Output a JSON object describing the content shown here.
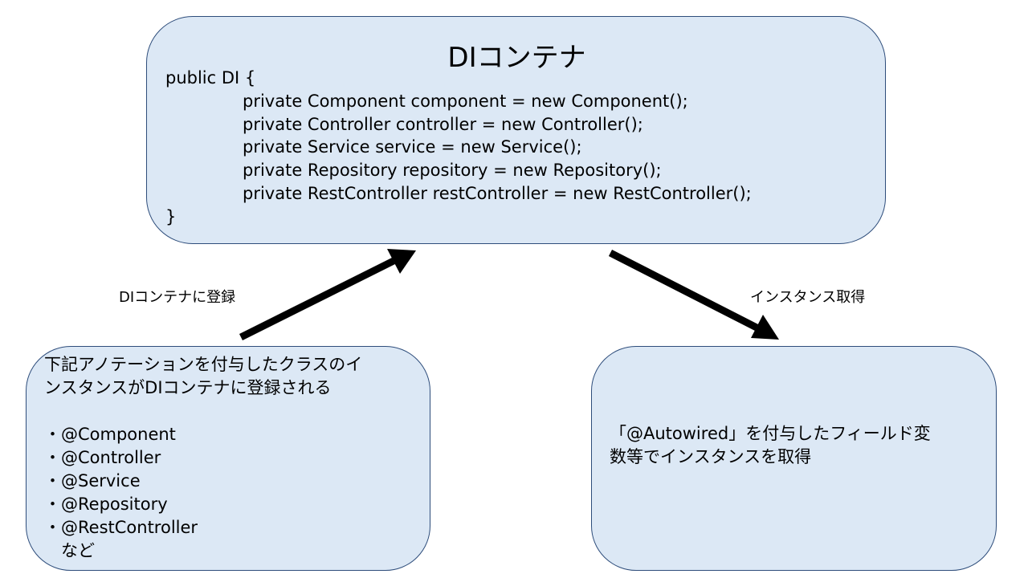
{
  "top_box": {
    "title": "DIコンテナ",
    "code_lines": [
      "public DI {",
      "private Component component = new Component();",
      "private Controller controller = new Controller();",
      "private Service service = new Service();",
      "private Repository repository = new Repository();",
      "private RestController restController = new RestController();",
      "}"
    ]
  },
  "left_box": {
    "lines": [
      "下記アノテーションを付与したクラスのイ",
      "ンスタンスがDIコンテナに登録される",
      "",
      "・@Component",
      "・@Controller",
      "・@Service",
      "・@Repository",
      "・@RestController",
      "　など"
    ]
  },
  "right_box": {
    "lines": [
      "「@Autowired」を付与したフィールド変",
      "数等でインスタンスを取得"
    ]
  },
  "edges": {
    "register_label": "DIコンテナに登録",
    "obtain_label": "インスタンス取得"
  },
  "colors": {
    "box_fill": "#dce8f5",
    "box_border": "#2e4d7b",
    "arrow": "#000000"
  }
}
